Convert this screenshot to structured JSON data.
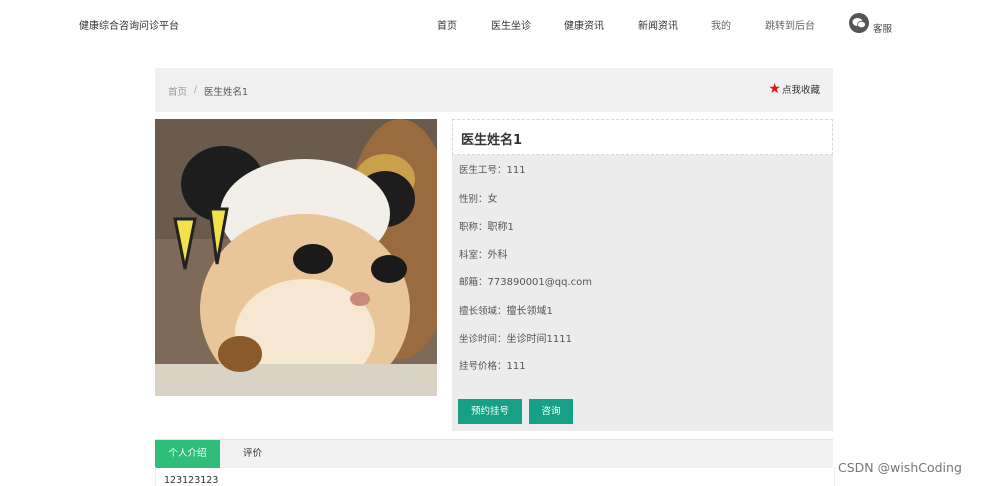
{
  "header": {
    "site_title": "健康综合咨询问诊平台",
    "nav": [
      "首页",
      "医生坐诊",
      "健康资讯",
      "新闻资讯",
      "我的",
      "跳转到后台"
    ],
    "service_label": "客服"
  },
  "breadcrumb": {
    "home": "首页",
    "separator": "/",
    "current": "医生姓名1"
  },
  "favorite_label": "点我收藏",
  "doctor": {
    "name": "医生姓名1",
    "fields": [
      {
        "label": "医生工号：",
        "value": "111"
      },
      {
        "label": "性别：",
        "value": "女"
      },
      {
        "label": "职称：",
        "value": "职称1"
      },
      {
        "label": "科室：",
        "value": "外科"
      },
      {
        "label": "邮箱：",
        "value": "773890001@qq.com"
      },
      {
        "label": "擅长领域：",
        "value": "擅长领域1"
      },
      {
        "label": "坐诊时间：",
        "value": "坐诊时间1111"
      },
      {
        "label": "挂号价格：",
        "value": "111"
      }
    ]
  },
  "actions": {
    "register": "预约挂号",
    "consult": "咨询"
  },
  "tabs": {
    "active": "个人介绍",
    "other": "评价"
  },
  "intro_text": "123123123",
  "watermark": "CSDN @wishCoding",
  "colors": {
    "primary_button": "#16a085",
    "active_tab": "#2ebe7a",
    "star": "#e3131b"
  }
}
